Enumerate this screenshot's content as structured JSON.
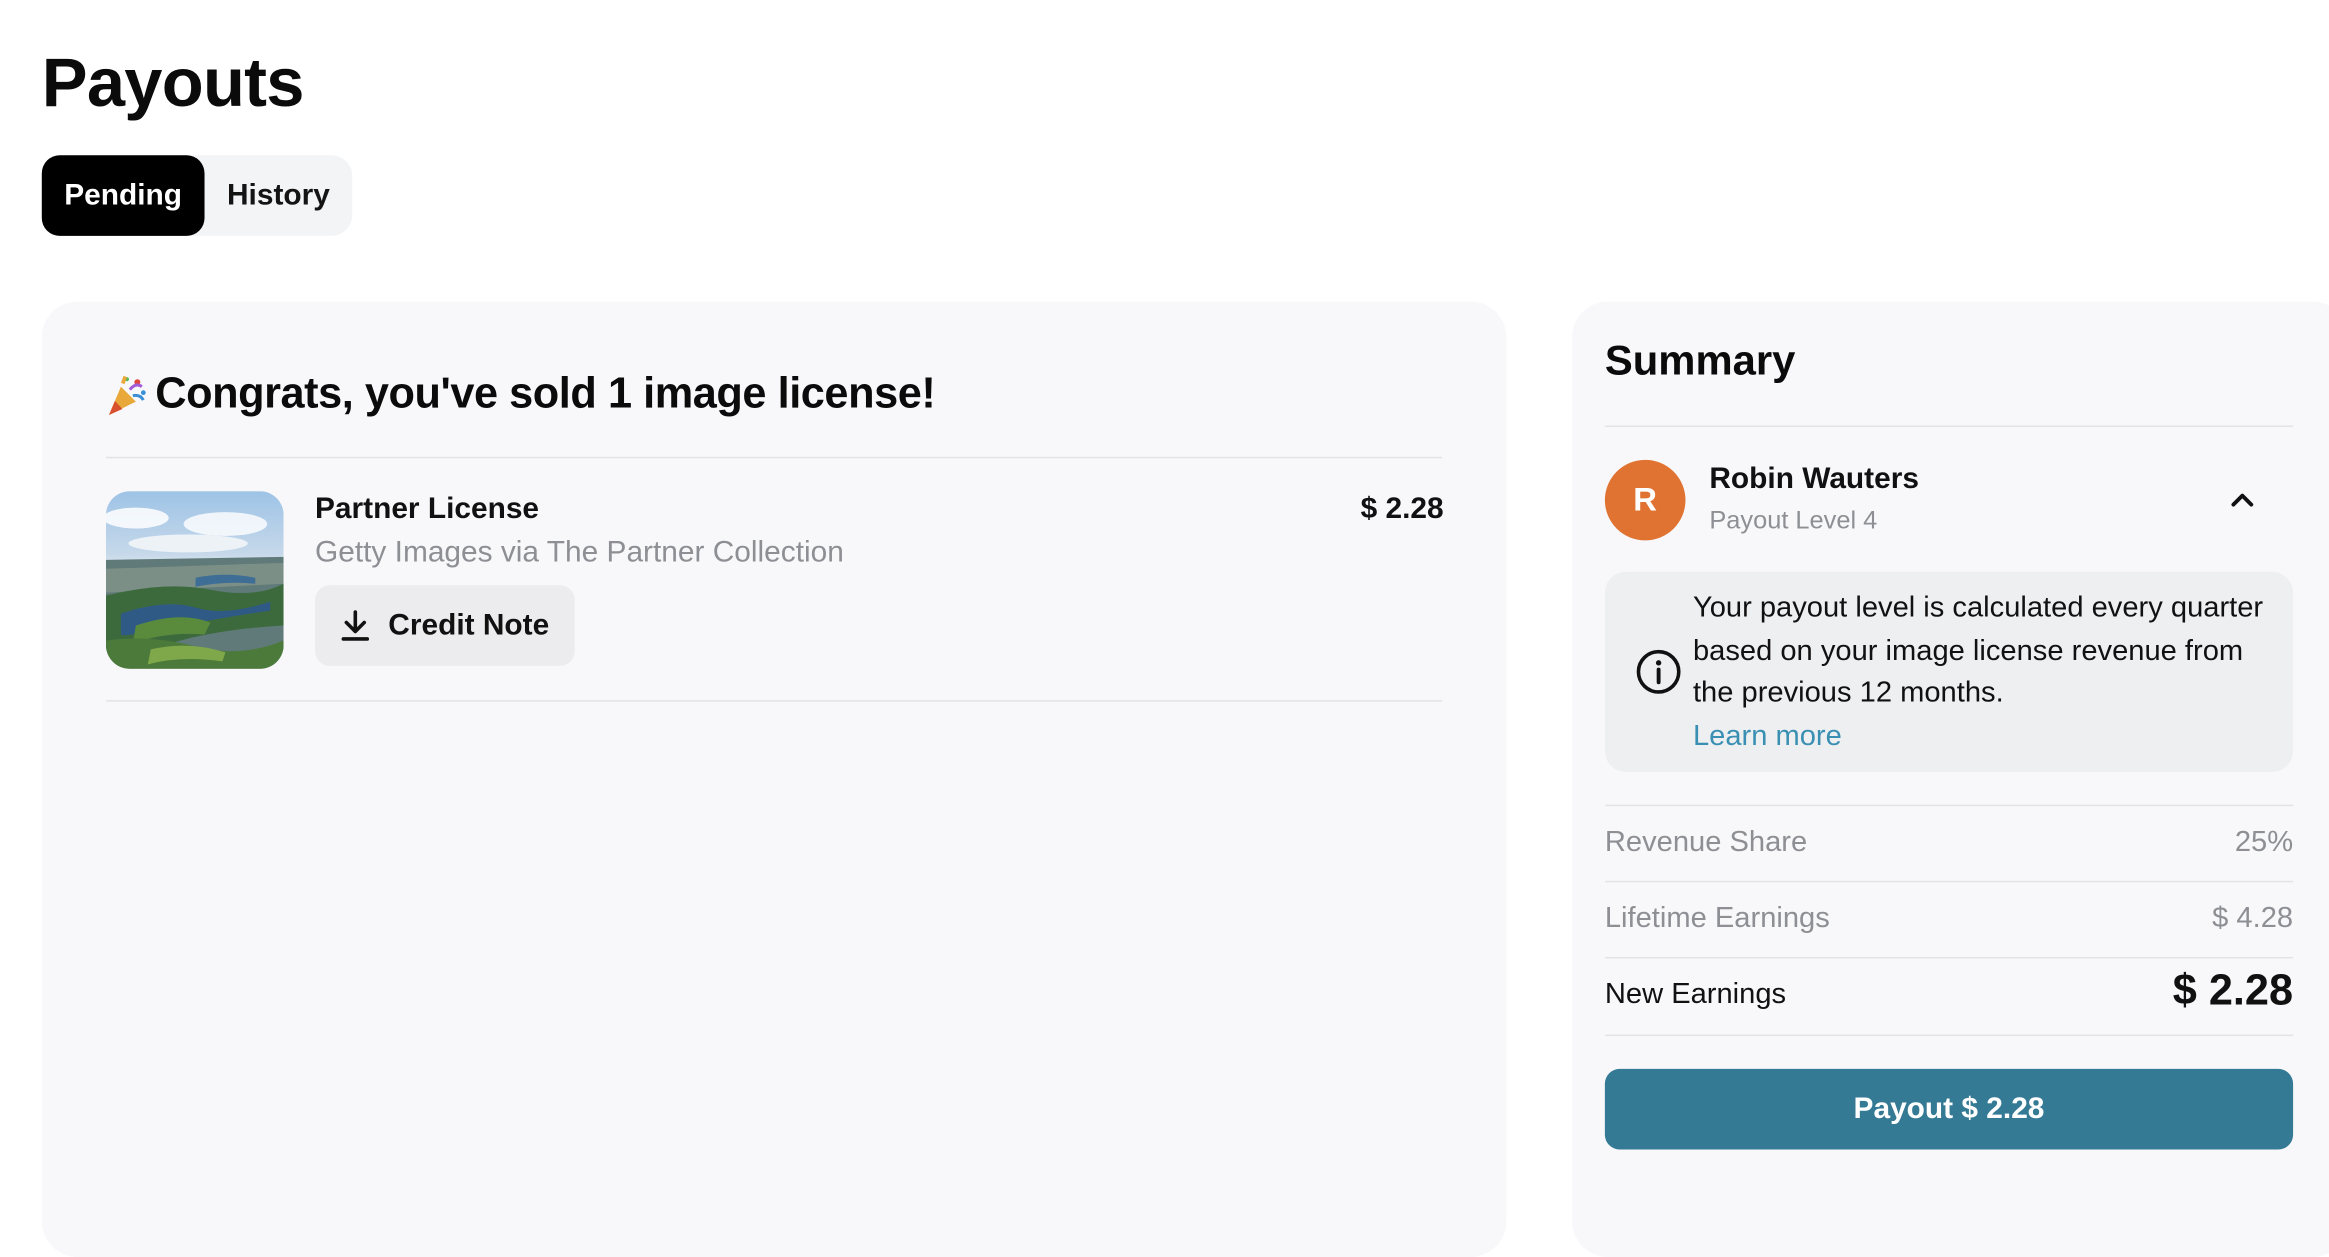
{
  "page": {
    "title": "Payouts"
  },
  "tabs": [
    {
      "label": "Pending",
      "active": true
    },
    {
      "label": "History",
      "active": false
    }
  ],
  "main": {
    "congrats_icon": "party-popper-icon",
    "congrats_text": "Congrats, you've sold 1 image license!",
    "licenses": [
      {
        "thumbnail": "aerial-landscape-photo",
        "title": "Partner License",
        "source": "Getty Images via The Partner Collection",
        "price": "$ 2.28",
        "credit_note_label": "Credit Note",
        "credit_note_icon": "download-icon"
      }
    ]
  },
  "summary": {
    "title": "Summary",
    "user": {
      "initial": "R",
      "name": "Robin Wauters",
      "level": "Payout Level 4",
      "avatar_color": "#e07332",
      "expand_icon": "chevron-up-icon"
    },
    "info": {
      "icon": "info-icon",
      "text": "Your payout level is calculated every quarter based on your image license revenue from the previous 12 months.",
      "link_label": "Learn more"
    },
    "rows": [
      {
        "label": "Revenue Share",
        "value": "25%"
      },
      {
        "label": "Lifetime Earnings",
        "value": "$ 4.28"
      },
      {
        "label": "New Earnings",
        "value": "$ 2.28"
      }
    ],
    "payout_button_label": "Payout $ 2.28",
    "accent_color": "#357a95"
  }
}
